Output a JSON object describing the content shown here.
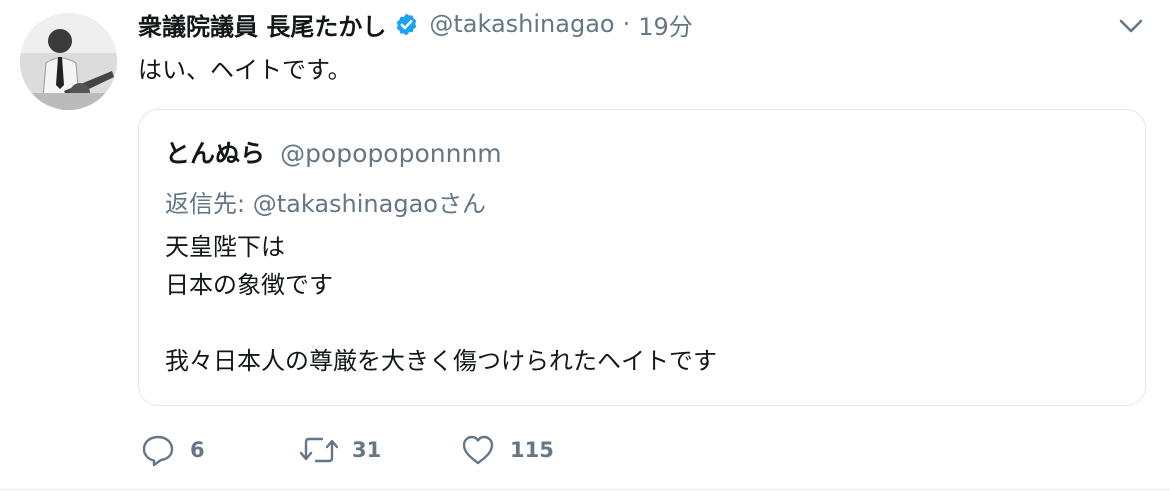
{
  "tweet": {
    "author_name": "衆議院議員 長尾たかし",
    "author_handle": "@takashinagao",
    "separator": "·",
    "time": "19分",
    "verified_icon": "verified-badge-icon",
    "text": "はい、ヘイトです。"
  },
  "quote": {
    "author_name": "とんぬら",
    "author_handle": "@popopoponnnm",
    "reply_prefix": "返信先:",
    "reply_handle": "@takashinagao",
    "reply_suffix": "さん",
    "lines": [
      "天皇陛下は",
      "日本の象徴です",
      "",
      "我々日本人の尊厳を大きく傷つけられたヘイトです"
    ]
  },
  "actions": {
    "reply_icon": "reply-icon",
    "reply_count": "6",
    "retweet_icon": "retweet-icon",
    "retweet_count": "31",
    "like_icon": "heart-icon",
    "like_count": "115"
  },
  "colors": {
    "text": "#14171a",
    "secondary": "#657786",
    "verified": "#1da1f2",
    "border": "#e1e8ed"
  }
}
